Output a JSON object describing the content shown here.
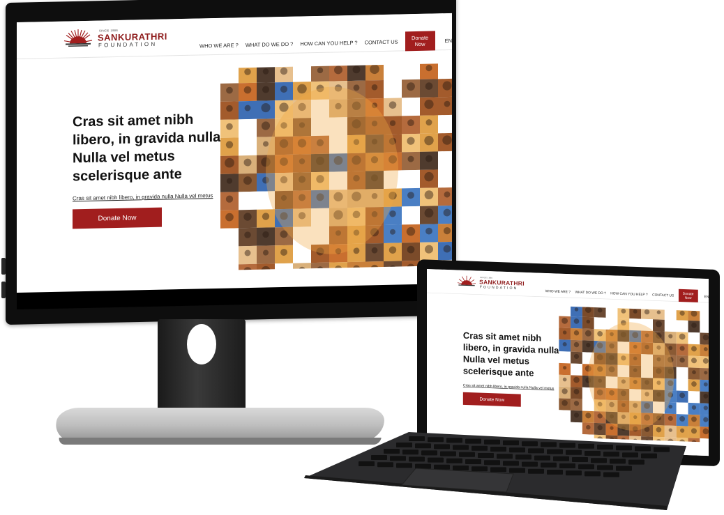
{
  "site": {
    "logo_small": "SINCE 1986",
    "logo_name": "SANKURATHRI",
    "logo_sub": "FOUNDATION",
    "nav": [
      {
        "label": "WHO WE ARE ?"
      },
      {
        "label": "WHAT DO WE DO ?"
      },
      {
        "label": "HOW CAN YOU HELP ?"
      },
      {
        "label": "CONTACT US"
      }
    ],
    "nav_donate": "Donate Now",
    "lang": "EN",
    "hero_title": "Cras sit amet nibh libero, in gravida nulla. Nulla vel metus scelerisque ante",
    "hero_sub": "Cras sit amet nibh libero, in gravida nulla Nulla vel metus",
    "hero_button": "Donate Now"
  },
  "colors": {
    "brand": "#a11e1e",
    "text": "#111111"
  },
  "icons": {
    "logo": "sun-rays-logo-icon"
  }
}
